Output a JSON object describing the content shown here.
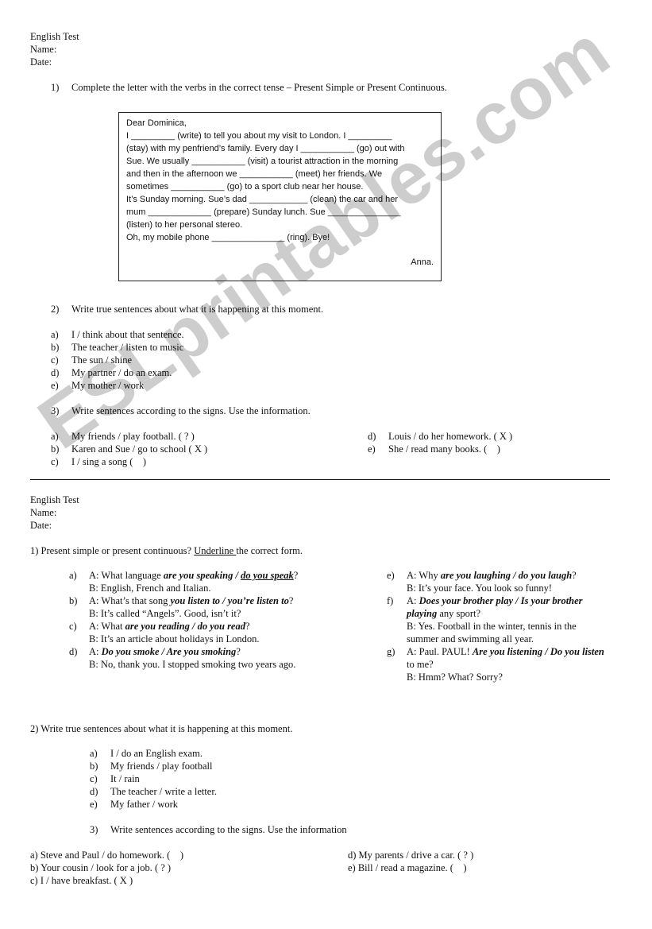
{
  "watermark": "ESLprintables.com",
  "test1": {
    "header": {
      "title": "English Test",
      "name_label": "Name:",
      "date_label": "Date:"
    },
    "q1": {
      "number": "1)",
      "instruction": "Complete the letter with the verbs in the correct tense – Present Simple or Present Continuous.",
      "letter": {
        "lines": [
          "Dear Dominica,",
          "I _________ (write) to tell you about my visit to London. I _________",
          "(stay) with my penfriend’s family. Every day I ___________ (go) out with",
          "Sue. We usually ___________ (visit) a tourist attraction in the morning",
          "and then in the afternoon we ___________ (meet) her friends. We",
          "sometimes ___________ (go) to a sport club near her house.",
          "It’s Sunday morning. Sue’s dad ____________ (clean) the car and her",
          "mum _____________ (prepare) Sunday lunch. Sue _______________",
          "(listen) to her personal stereo.",
          "Oh, my mobile phone _______________ (ring). Bye!"
        ],
        "signature": "Anna."
      }
    },
    "q2": {
      "number": "2)",
      "instruction": "Write true sentences about what it is happening at this moment.",
      "items": [
        {
          "label": "a)",
          "text": "I / think about that sentence."
        },
        {
          "label": "b)",
          "text": "The teacher / listen to music"
        },
        {
          "label": "c)",
          "text": "The sun / shine"
        },
        {
          "label": "d)",
          "text": "My partner / do an exam."
        },
        {
          "label": "e)",
          "text": "My mother / work"
        }
      ]
    },
    "q3": {
      "number": "3)",
      "instruction": "Write sentences according to the signs. Use the information.",
      "left_items": [
        {
          "label": "a)",
          "text": "My friends / play football. ( ? )"
        },
        {
          "label": "b)",
          "text": "Karen and Sue / go to school ( X )"
        },
        {
          "label": "c)",
          "text": "I / sing a song (    )"
        }
      ],
      "right_items": [
        {
          "label": "d)",
          "text": "Louis / do her homework. ( X )"
        },
        {
          "label": "e)",
          "text": "She / read many books. (    )"
        }
      ]
    }
  },
  "test2": {
    "header": {
      "title": "English Test",
      "name_label": "Name:",
      "date_label": "Date:"
    },
    "q1": {
      "instruction_before": "1) Present simple or present continuous? ",
      "instruction_underlined": "Underline ",
      "instruction_after": "the correct form.",
      "items": {
        "a": {
          "label": "a)",
          "a_pre": "A: What language ",
          "opt1": "are you speaking / ",
          "opt2": "do you speak",
          "a_post": "?",
          "b": "B: English, French and Italian."
        },
        "b": {
          "label": "b)",
          "a_pre": "A: What’s that song ",
          "opt": "you listen to / you’re listen to",
          "a_post": "?",
          "b": "B: It’s called “Angels”. Good, isn’t it?"
        },
        "c": {
          "label": "c)",
          "a_pre": "A: What ",
          "opt": "are you reading / do you read",
          "a_post": "?",
          "b": "B: It’s an article about holidays in London."
        },
        "d": {
          "label": "d)",
          "a_pre": "A: ",
          "opt": "Do you smoke / Are you smoking",
          "a_post": "?",
          "b": "B: No, thank you. I stopped smoking two years ago."
        },
        "e": {
          "label": "e)",
          "a_pre": "A: Why ",
          "opt": "are you laughing / do you laugh",
          "a_post": "?",
          "b": "B: It’s your face. You look so funny!"
        },
        "f": {
          "label": "f)",
          "a_pre": "A: ",
          "opt": "Does your brother play / Is your brother playing",
          "a_post": " any sport?",
          "b": "B: Yes. Football in the winter, tennis in the summer and swimming all year."
        },
        "g": {
          "label": "g)",
          "a_pre": "A: Paul. PAUL! ",
          "opt": "Are you listening / Do you listen",
          "a_post": " to me?",
          "b": "B: Hmm? What? Sorry?"
        }
      }
    },
    "q2": {
      "instruction": "2) Write true sentences about what it is happening at this moment.",
      "items": [
        {
          "label": "a)",
          "text": "I / do an English exam."
        },
        {
          "label": "b)",
          "text": "My friends / play football"
        },
        {
          "label": "c)",
          "text": "It / rain"
        },
        {
          "label": "d)",
          "text": "The teacher / write a letter."
        },
        {
          "label": "e)",
          "text": "My father / work"
        }
      ]
    },
    "q3": {
      "number": "3)",
      "instruction": "Write sentences according to the signs. Use the information",
      "left_items": [
        "a) Steve and Paul / do homework. (    )",
        "b) Your cousin / look for a job. ( ? )",
        "c) I / have breakfast. ( X )"
      ],
      "right_items": [
        "d) My parents / drive a car. ( ? )",
        "e) Bill / read a magazine. (    )"
      ]
    }
  }
}
